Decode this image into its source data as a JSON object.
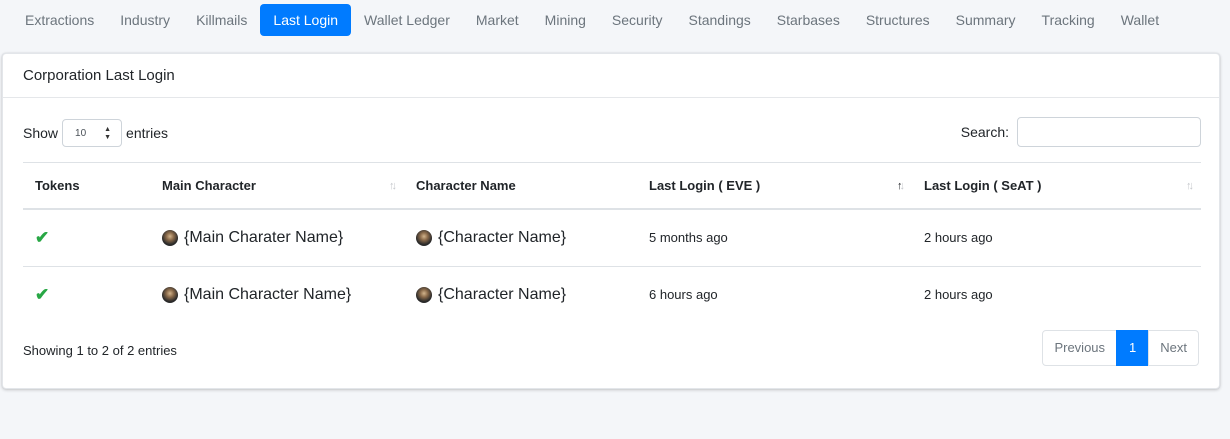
{
  "tabs": [
    "Extractions",
    "Industry",
    "Killmails",
    "Last Login",
    "Wallet Ledger",
    "Market",
    "Mining",
    "Security",
    "Standings",
    "Starbases",
    "Structures",
    "Summary",
    "Tracking",
    "Wallet"
  ],
  "active_tab": "Last Login",
  "card": {
    "title": "Corporation Last Login"
  },
  "length": {
    "show_label": "Show",
    "value": "10",
    "entries_label": "entries"
  },
  "search": {
    "label": "Search:",
    "value": ""
  },
  "columns": [
    "Tokens",
    "Main Character",
    "Character Name",
    "Last Login ( EVE )",
    "Last Login ( SeAT )"
  ],
  "rows": [
    {
      "token": "✔",
      "main": "{Main Charater Name}",
      "char": "{Character Name}",
      "eve": "5 months ago",
      "seat": "2 hours ago"
    },
    {
      "token": "✔",
      "main": "{Main Character Name}",
      "char": "{Character Name}",
      "eve": "6 hours ago",
      "seat": "2 hours ago"
    }
  ],
  "footer": {
    "info": "Showing 1 to 2 of 2 entries",
    "prev": "Previous",
    "page": "1",
    "next": "Next"
  },
  "colors": {
    "accent": "#007bff",
    "check": "#28a745"
  }
}
